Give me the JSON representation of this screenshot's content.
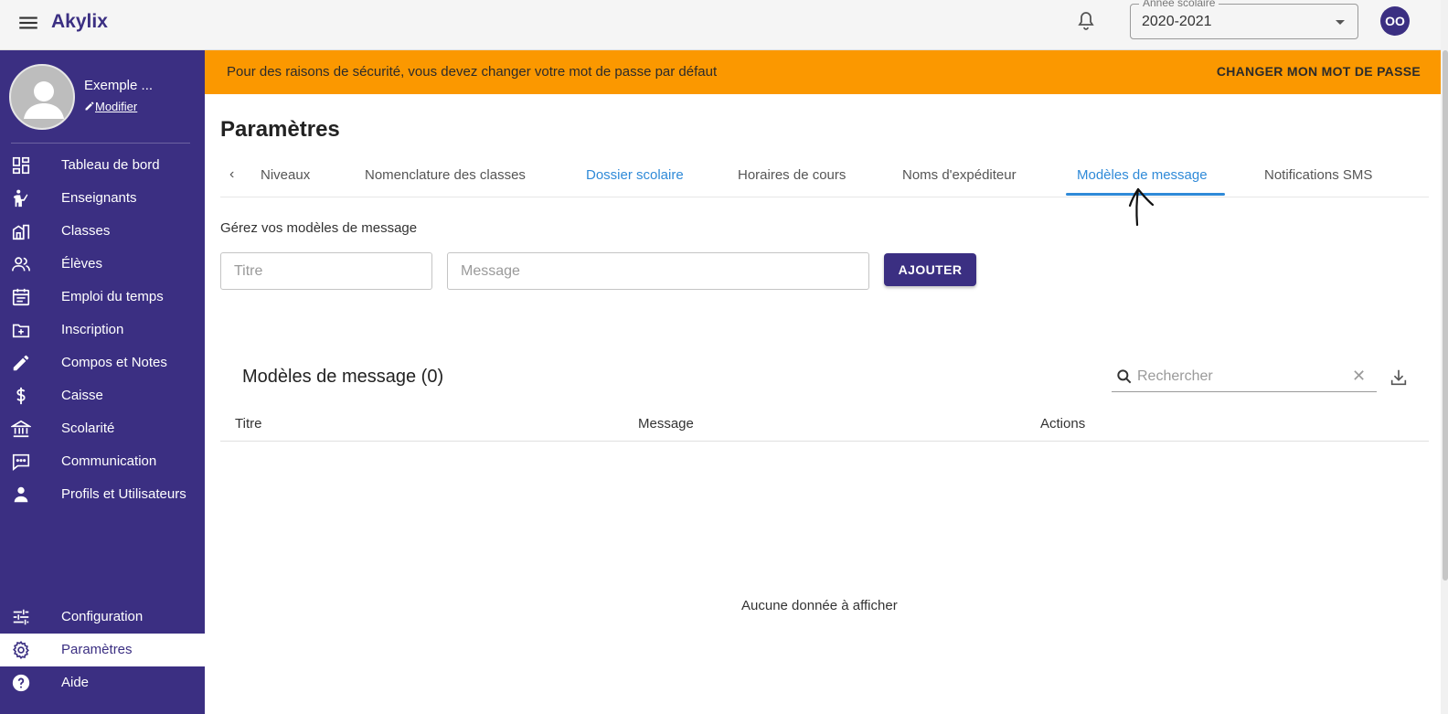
{
  "app": {
    "title": "Akylix"
  },
  "header": {
    "year_label": "Année scolaire",
    "year_value": "2020-2021",
    "user_initials": "OO"
  },
  "profile": {
    "name": "Exemple ...",
    "edit_label": "Modifier"
  },
  "sidebar": {
    "items": [
      {
        "label": "Tableau de bord",
        "icon": "dashboard-icon"
      },
      {
        "label": "Enseignants",
        "icon": "teacher-icon"
      },
      {
        "label": "Classes",
        "icon": "building-icon"
      },
      {
        "label": "Élèves",
        "icon": "students-icon"
      },
      {
        "label": "Emploi du temps",
        "icon": "calendar-icon"
      },
      {
        "label": "Inscription",
        "icon": "folder-plus-icon"
      },
      {
        "label": "Compos et Notes",
        "icon": "pencil-icon"
      },
      {
        "label": "Caisse",
        "icon": "dollar-icon"
      },
      {
        "label": "Scolarité",
        "icon": "bank-icon"
      },
      {
        "label": "Communication",
        "icon": "chat-icon"
      },
      {
        "label": "Profils et Utilisateurs",
        "icon": "person-icon"
      }
    ],
    "bottom_items": [
      {
        "label": "Configuration",
        "icon": "sliders-icon"
      },
      {
        "label": "Paramètres",
        "icon": "gear-icon",
        "active": true
      },
      {
        "label": "Aide",
        "icon": "help-icon"
      }
    ]
  },
  "banner": {
    "text": "Pour des raisons de sécurité, vous devez changer votre mot de passe par défaut",
    "button_label": "CHANGER MON MOT DE PASSE"
  },
  "page": {
    "title": "Paramètres"
  },
  "tabs": [
    {
      "label": "Niveaux"
    },
    {
      "label": "Nomenclature des classes"
    },
    {
      "label": "Dossier scolaire"
    },
    {
      "label": "Horaires de cours"
    },
    {
      "label": "Noms d'expéditeur"
    },
    {
      "label": "Modèles de message",
      "active": true
    },
    {
      "label": "Notifications SMS"
    }
  ],
  "form": {
    "hint": "Gérez vos modèles de message",
    "title_placeholder": "Titre",
    "message_placeholder": "Message",
    "add_label": "AJOUTER"
  },
  "table": {
    "title": "Modèles de message (0)",
    "search_placeholder": "Rechercher",
    "columns": [
      "Titre",
      "Message",
      "Actions"
    ],
    "empty_text": "Aucune donnée à afficher"
  },
  "colors": {
    "primary": "#3b2f82",
    "warning": "#fb9800",
    "link": "#2f8ad8"
  }
}
